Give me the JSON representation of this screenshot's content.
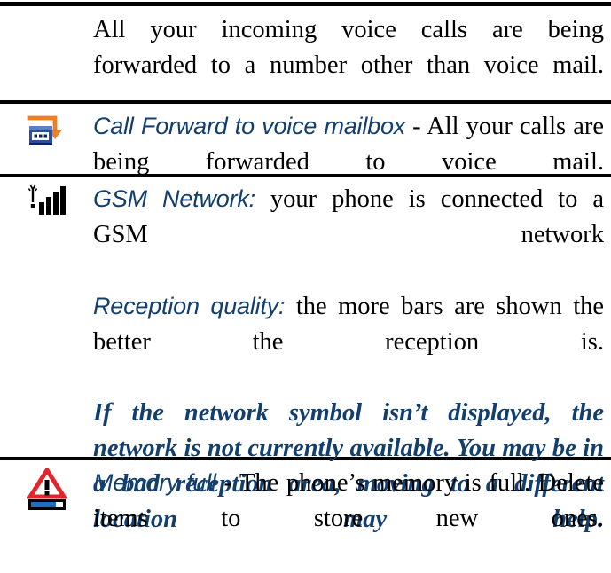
{
  "document": {
    "type": "phone-manual-status-icon-table",
    "rows": [
      {
        "icon": "none",
        "label": "",
        "body": "All your incoming voice calls are being forwarded to a number other than voice mail."
      },
      {
        "icon": "call-forward-to-voice-mailbox-icon",
        "label": "Call Forward to voice mailbox",
        "body": " - All your calls are being forwarded to voice mail."
      },
      {
        "icon": "gsm-network-signal-bars-icon",
        "label": "GSM Network:",
        "body": " your phone is connected to a GSM network",
        "label2": "Reception quality:",
        "body2": " the more bars are shown the better the reception is.",
        "note": "If the network symbol isn’t displayed, the network is not currently available. You may be in a bad reception area, moving to a different location may help."
      },
      {
        "icon": "memory-full-warning-icon",
        "label": "Memory full",
        "body": " - The phone’s memory is full. Delete items to store new ones."
      }
    ]
  },
  "colors": {
    "label_blue": "#123f6d",
    "body_black": "#000000",
    "rule_black": "#000000",
    "icon_orange": "#f08game",
    "icon_orange_fixed": "#ee7f22",
    "icon_blue": "#2a4e9b",
    "icon_red": "#e1252b",
    "page_background": "#ffffff"
  }
}
